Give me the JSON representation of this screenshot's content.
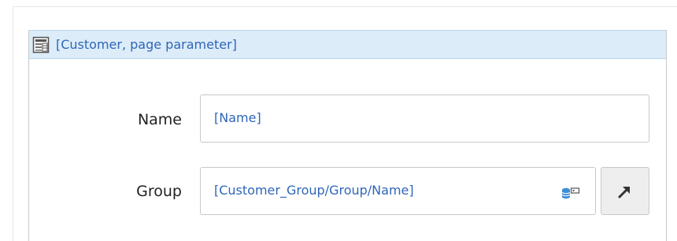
{
  "panel": {
    "title": "[Customer, page parameter]",
    "icon": "data-view-icon"
  },
  "fields": [
    {
      "label": "Name",
      "value": "[Name]"
    },
    {
      "label": "Group",
      "value": "[Customer_Group/Group/Name]",
      "trailing_icon": "database-key-icon",
      "action_icon": "arrow-up-right-icon"
    }
  ],
  "colors": {
    "header_bg": "#dcecf9",
    "header_border": "#b9d5ea",
    "link_text": "#2f66b8",
    "label_text": "#222222",
    "input_border": "#c8c8c8",
    "button_bg": "#eeeeee",
    "db_icon": "#3d8fd6"
  }
}
